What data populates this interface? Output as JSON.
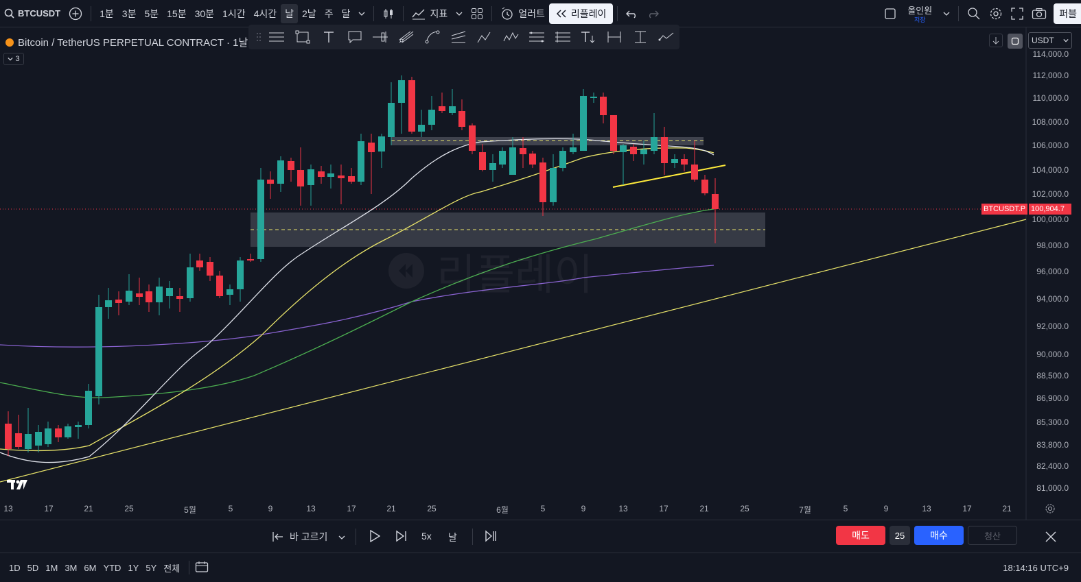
{
  "topbar": {
    "symbol": "BTCUSDT",
    "intervals": [
      "1분",
      "3분",
      "5분",
      "15분",
      "30분",
      "1시간",
      "4시간",
      "날",
      "2날",
      "주",
      "달"
    ],
    "active_interval": "날",
    "indicators_label": "지표",
    "alerts_label": "얼러트",
    "replay_label": "리플레이",
    "layout_name": "올인원",
    "layout_sub": "저장",
    "publish_label": "퍼블"
  },
  "legend": {
    "title": "Bitcoin / TetherUS PERPETUAL CONTRACT · 1날",
    "collapse_count": "3"
  },
  "axis": {
    "currency": "USDT",
    "price_labels": [
      "114,000.0",
      "112,000.0",
      "110,000.0",
      "108,000.0",
      "106,000.0",
      "104,000.0",
      "102,000.0",
      "100,000.0",
      "98,000.0",
      "96,000.0",
      "94,000.0",
      "92,000.0",
      "90,000.0",
      "88,500.0",
      "86,900.0",
      "85,300.0",
      "83,800.0",
      "82,400.0",
      "81,000.0"
    ],
    "time_labels": [
      "13",
      "17",
      "21",
      "25",
      "5월",
      "5",
      "9",
      "13",
      "17",
      "21",
      "25",
      "6월",
      "5",
      "9",
      "13",
      "17",
      "21",
      "25",
      "7월",
      "5",
      "9",
      "13",
      "17",
      "21"
    ],
    "current_symbol_tag": "BTCUSDT.P",
    "current_price": "100,904.7"
  },
  "watermark": "리플레이",
  "replay_bar": {
    "select_bar_label": "바 고르기",
    "speed": "5x",
    "interval": "날"
  },
  "trade": {
    "sell_label": "매도",
    "quantity": "25",
    "buy_label": "매수",
    "close_label": "청산"
  },
  "footer": {
    "ranges": [
      "1D",
      "5D",
      "1M",
      "3M",
      "6M",
      "YTD",
      "1Y",
      "5Y",
      "전체"
    ],
    "clock": "18:14:16 UTC+9"
  },
  "colors": {
    "background": "#131722",
    "up": "#26a69a",
    "down": "#f23645",
    "accent": "#2962ff"
  }
}
